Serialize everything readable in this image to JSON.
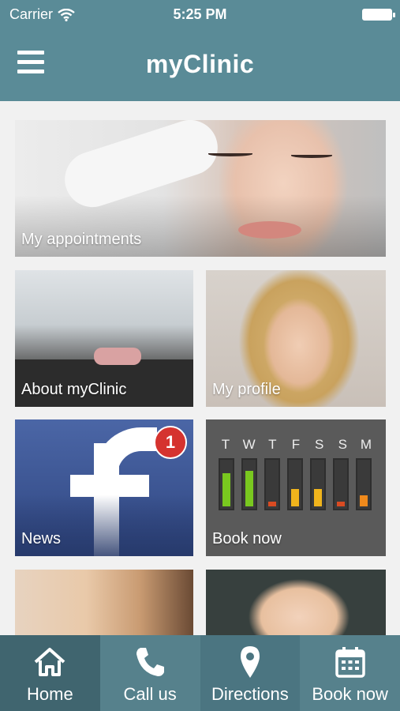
{
  "status_bar": {
    "carrier": "Carrier",
    "time": "5:25 PM"
  },
  "header": {
    "title": "myClinic"
  },
  "tiles": {
    "appointments": "My appointments",
    "about": "About myClinic",
    "profile": "My profile",
    "news": "News",
    "news_badge": "1",
    "book": "Book now"
  },
  "booking_widget": {
    "days": [
      "T",
      "W",
      "T",
      "F",
      "S",
      "S",
      "M"
    ],
    "levels": [
      0.75,
      0.8,
      0.1,
      0.4,
      0.4,
      0.1,
      0.25
    ],
    "colors": [
      "#79c81f",
      "#79c81f",
      "#d94b22",
      "#f0b41c",
      "#f0b41c",
      "#d94b22",
      "#f08a1c"
    ]
  },
  "tabbar": {
    "home": "Home",
    "call": "Call us",
    "directions": "Directions",
    "book": "Book now"
  },
  "colors": {
    "header": "#5a8b97",
    "tabbar": "#4e7984",
    "badge": "#d5332f"
  }
}
